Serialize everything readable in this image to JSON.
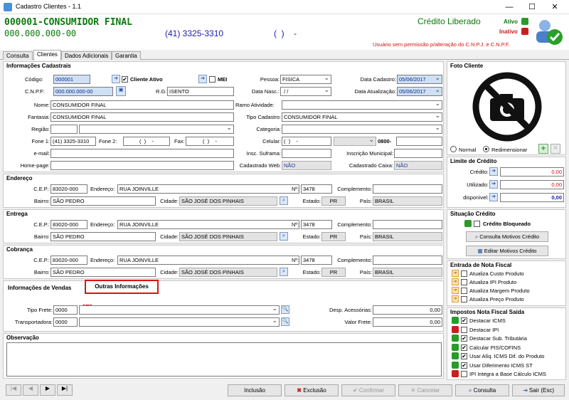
{
  "window": {
    "title": "Cadastro Clientes  - 1.1",
    "min": "—",
    "max": "☐",
    "close": "✕"
  },
  "header": {
    "client": "000001-CONSUMIDOR FINAL",
    "cnpj": "000.000.000-00",
    "phone": "(41) 3325-3310",
    "phone2": "(  )    -",
    "credit": "Crédito Liberado",
    "ativo": "Ativo",
    "inativo": "Inativo",
    "warning": "Usuário sem permissão p/alteração do C.N.P.J.  e C.N.P.F."
  },
  "tabs": [
    "Consulta",
    "Clientes",
    "Dados Adicionais",
    "Garantia"
  ],
  "cad": {
    "title": "Informações Cadastrais",
    "codigo_l": "Código:",
    "codigo": "000001",
    "ativo_l": "Cliente Ativo",
    "mei_l": "MEI",
    "pessoa_l": "Pessoa:",
    "pessoa": "FISICA",
    "dtcad_l": "Data Cadastro:",
    "dtcad": "05/06/2017",
    "cnpf_l": "C.N.P.F:",
    "cnpf": "000.000.000-00",
    "rg_l": "R.G:",
    "rg": "ISENTO",
    "nasc_l": "Data Nasc.:",
    "nasc": " / /",
    "dtat_l": "Data Atualização:",
    "dtat": "05/06/2017",
    "nome_l": "Nome:",
    "nome": "CONSUMIDOR FINAL",
    "ramo_l": "Ramo Atividade:",
    "fant_l": "Fantasia:",
    "fant": "CONSUMIDOR FINAL",
    "tipo_l": "Tipo Cadastro:",
    "tipo": "CONSUMIDOR FINAL",
    "reg_l": "Região:",
    "cat_l": "Categoria:",
    "f1_l": "Fone 1:",
    "f1": "(41) 3325-3310",
    "f2_l": "Fone 2:",
    "f2": "(  )    -",
    "fax_l": "Fax:",
    "fax": "(  )    -",
    "cel_l": "Celular:",
    "cel": "(  )    -",
    "n0800": "0800-",
    "mail_l": "e-mail:",
    "suf_l": "Insc. Suframa:",
    "im_l": "Inscrição Municipal:",
    "home_l": "Home-page:",
    "cw_l": "Cadastrado Web:",
    "cw": "NÃO",
    "cc_l": "Cadastrado Caixa:",
    "cc": "NÃO"
  },
  "addresses": [
    {
      "title": "Endereço",
      "cep": "83020-000",
      "end": "RUA JOINVILLE",
      "num": "3478",
      "bairro": "SÃO PEDRO",
      "cidade": "SÃO JOSÉ DOS PINHAIS",
      "uf": "PR",
      "pais": "BRASIL"
    },
    {
      "title": "Entrega",
      "cep": "83020-000",
      "end": "RUA JOINVILLE",
      "num": "3478",
      "bairro": "SÃO PEDRO",
      "cidade": "SÃO JOSÉ DOS PINHAIS",
      "uf": "PR",
      "pais": "BRASIL"
    },
    {
      "title": "Cobrança",
      "cep": "83020-000",
      "end": "RUA JOINVILLE",
      "num": "3478",
      "bairro": "SÃO PEDRO",
      "cidade": "SÃO JOSÉ DOS PINHAIS",
      "uf": "PR",
      "pais": "BRASIL"
    }
  ],
  "addr_labels": {
    "cep": "C.E.P.:",
    "end": "Endereço:",
    "num": "Nº:",
    "comp": "Complemento:",
    "bairro": "Bairro:",
    "cidade": "Cidade:",
    "estado": "Estado:",
    "pais": "País:"
  },
  "vendas": {
    "tab1": "Informações de Vendas",
    "tab2": "Outras Informações",
    "marker": "(5)",
    "frete_l": "Tipo Frete:",
    "frete": "0000",
    "transp_l": "Transportadora:",
    "transp": "0000",
    "desp_l": "Desp. Acessórias:",
    "desp": "0,00",
    "vfrete_l": "Valor Frete:",
    "vfrete": "0,00"
  },
  "obs": {
    "title": "Observação"
  },
  "bottom": {
    "nav": [
      "|◀",
      "◀",
      "▶",
      "▶|"
    ],
    "incluir": "Inclusão",
    "excluir": "Exclusão",
    "confirmar": "Confirmar",
    "cancelar": "Cancelar",
    "consulta": "Consulta",
    "sair": "Sair (Esc)"
  },
  "foto": {
    "title": "Foto Cliente",
    "normal": "Normal",
    "redim": "Redimensionar"
  },
  "limite": {
    "title": "Limite de Crédito",
    "cred_l": "Crédito:",
    "cred": "0,00",
    "util_l": "Utilizado:",
    "util": "0,00",
    "disp_l": "disponível:",
    "disp": "0,00"
  },
  "situacao": {
    "title": "Situação Crédito",
    "bloq": "Crédito Bloqueado",
    "consulta": "Consulta Motivos Crédito",
    "editar": "Editar Motivos Crédito"
  },
  "entrada": {
    "title": "Entrada de Nota Fiscal",
    "items": [
      "Atualiza Custo Produto",
      "Atualiza IPI Produto",
      "Atualiza Margem Produto",
      "Atualiza Preço Produto"
    ]
  },
  "impostos": {
    "title": "Impostos Nota Fiscal Saída",
    "items": [
      {
        "label": "Destacar ICMS",
        "color": "#2a9a2a",
        "checked": "✔"
      },
      {
        "label": "Destacar IPI",
        "color": "#c81e1e",
        "checked": ""
      },
      {
        "label": "Destacar Sub. Tributária",
        "color": "#2a9a2a",
        "checked": "✔"
      },
      {
        "label": "Calcular PIS/COFINS",
        "color": "#2a9a2a",
        "checked": "✔"
      },
      {
        "label": "Usar Alíq. ICMS Dif. do Produto",
        "color": "#2a9a2a",
        "checked": "✔"
      },
      {
        "label": "Usar Diferimento ICMS ST",
        "color": "#2a9a2a",
        "checked": "✔"
      },
      {
        "label": "IPI Integra a Base Cálculo ICMS",
        "color": "#c81e1e",
        "checked": ""
      }
    ]
  }
}
